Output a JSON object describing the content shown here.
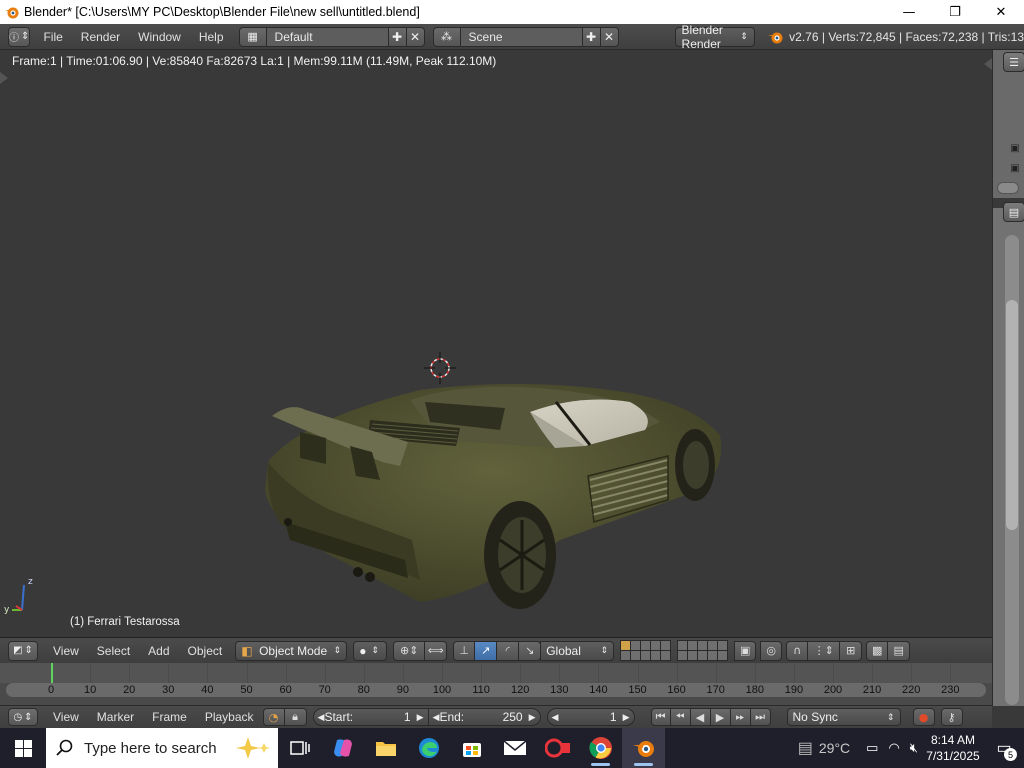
{
  "window": {
    "title": "Blender* [C:\\Users\\MY PC\\Desktop\\Blender File\\new sell\\untitled.blend]",
    "minimize": "—",
    "maximize": "❐",
    "close": "✕"
  },
  "info_header": {
    "menus": [
      "File",
      "Render",
      "Window",
      "Help"
    ],
    "screen_layout": "Default",
    "scene": "Scene",
    "render_engine": "Blender Render",
    "stats": "v2.76 | Verts:72,845 | Faces:72,238 | Tris:13"
  },
  "viewport": {
    "info_line": "Frame:1 | Time:01:06.90 | Ve:85840 Fa:82673 La:1 | Mem:99.11M (11.49M, Peak 112.10M)",
    "object_name": "(1) Ferrari Testarossa",
    "axis_z": "z",
    "axis_y": "y"
  },
  "view3d_header": {
    "menus": [
      "View",
      "Select",
      "Add",
      "Object"
    ],
    "mode": "Object Mode",
    "orientation": "Global"
  },
  "timeline": {
    "ticks": [
      "0",
      "10",
      "20",
      "30",
      "40",
      "50",
      "60",
      "70",
      "80",
      "90",
      "100",
      "110",
      "120",
      "130",
      "140",
      "150",
      "160",
      "170",
      "180",
      "190",
      "200",
      "210",
      "220",
      "230"
    ],
    "current_frame": "1"
  },
  "timeline_header": {
    "menus": [
      "View",
      "Marker",
      "Frame",
      "Playback"
    ],
    "start_label": "Start:",
    "start_value": "1",
    "end_label": "End:",
    "end_value": "250",
    "frame_value": "1",
    "sync": "No Sync"
  },
  "taskbar": {
    "search_placeholder": "Type here to search",
    "weather": "29°C",
    "time": "8:14 AM",
    "date": "7/31/2025",
    "notification_count": "5"
  },
  "colors": {
    "viewport_bg": "#393939",
    "car_body": "#4f5030",
    "taskbar": "#1f1f2b",
    "current_frame": "#5fd35f"
  }
}
